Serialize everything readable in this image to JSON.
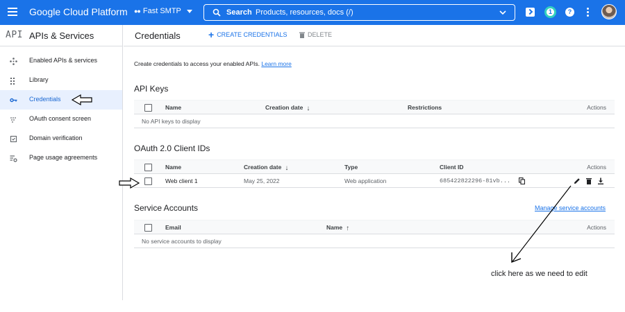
{
  "topbar": {
    "brand": "Google Cloud Platform",
    "project": "Fast SMTP",
    "search_label": "Search",
    "search_hint": "Products, resources, docs (/)",
    "notification_count": "1",
    "help_glyph": "?"
  },
  "sidebar": {
    "mark": "API",
    "title": "APIs & Services",
    "items": [
      {
        "label": "Enabled APIs & services",
        "icon": "diamond-icon"
      },
      {
        "label": "Library",
        "icon": "library-icon"
      },
      {
        "label": "Credentials",
        "icon": "key-icon",
        "active": true
      },
      {
        "label": "OAuth consent screen",
        "icon": "consent-icon"
      },
      {
        "label": "Domain verification",
        "icon": "checkbox-icon"
      },
      {
        "label": "Page usage agreements",
        "icon": "settings-list-icon"
      }
    ]
  },
  "header": {
    "title": "Credentials",
    "create_label": "CREATE CREDENTIALS",
    "delete_label": "DELETE"
  },
  "intro": {
    "text": "Create credentials to access your enabled APIs.",
    "link": "Learn more"
  },
  "api_keys": {
    "title": "API Keys",
    "columns": {
      "name": "Name",
      "created": "Creation date",
      "restrictions": "Restrictions",
      "actions": "Actions"
    },
    "empty": "No API keys to display"
  },
  "oauth": {
    "title": "OAuth 2.0 Client IDs",
    "columns": {
      "name": "Name",
      "created": "Creation date",
      "type": "Type",
      "client_id": "Client ID",
      "actions": "Actions"
    },
    "rows": [
      {
        "name": "Web client 1",
        "created": "May 25, 2022",
        "type": "Web application",
        "client_id": "685422822296-81vb..."
      }
    ]
  },
  "service_accounts": {
    "title": "Service Accounts",
    "manage_link": "Manage service accounts",
    "columns": {
      "email": "Email",
      "name": "Name",
      "actions": "Actions"
    },
    "empty": "No service accounts to display"
  },
  "annotation": {
    "text": "click here as we need to edit"
  },
  "colors": {
    "brand_blue": "#1a73e8",
    "active_bg": "#e8f0fe",
    "divider": "#dadce0"
  }
}
